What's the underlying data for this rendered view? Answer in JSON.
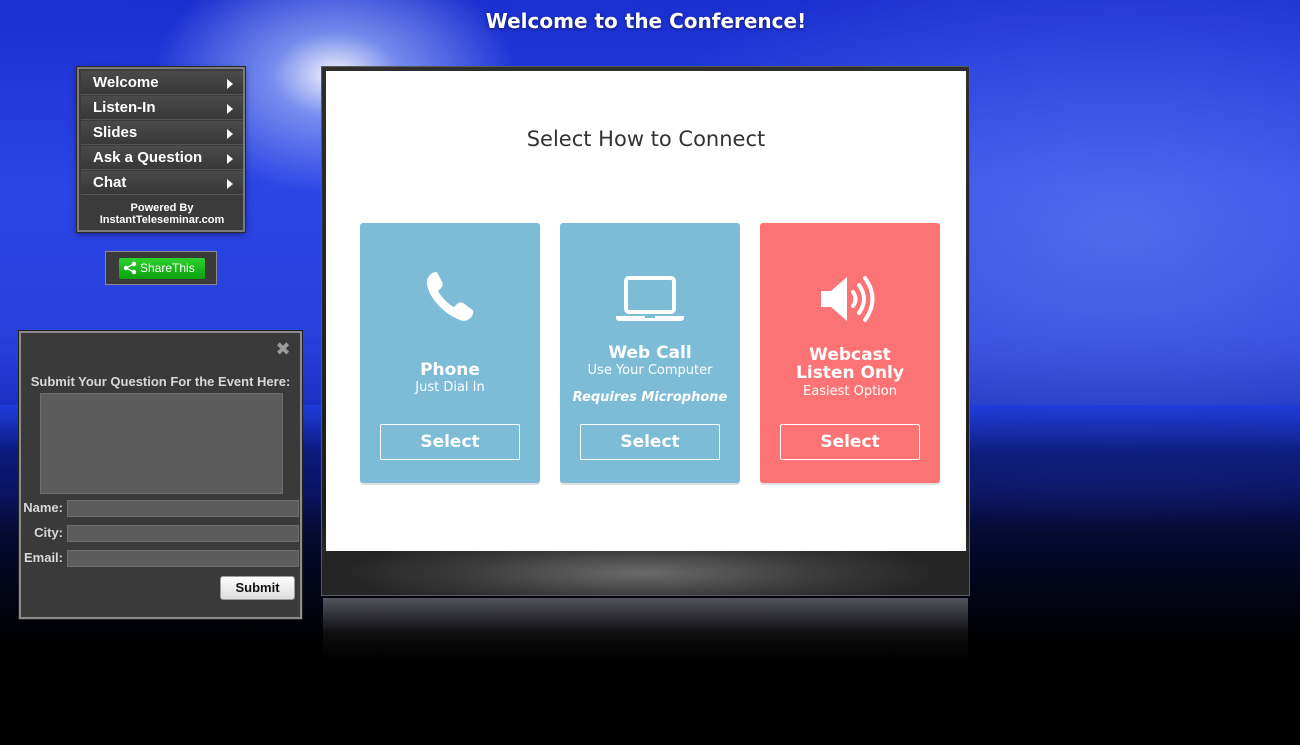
{
  "page": {
    "title": "Welcome to the Conference!"
  },
  "nav": {
    "items": [
      {
        "label": "Welcome"
      },
      {
        "label": "Listen-In"
      },
      {
        "label": "Slides"
      },
      {
        "label": "Ask a Question"
      },
      {
        "label": "Chat"
      }
    ],
    "powered_by_line1": "Powered By",
    "powered_by_line2": "InstantTeleseminar.com"
  },
  "share": {
    "label": "ShareThis",
    "icon": "share-icon",
    "color": "#12b312"
  },
  "connect": {
    "title": "Select How to Connect",
    "cards": [
      {
        "title": "Phone",
        "subtitle": "Just Dial In",
        "note": "",
        "button": "Select",
        "icon": "phone-icon",
        "color": "#7dbcd6"
      },
      {
        "title": "Web Call",
        "subtitle": "Use Your Computer",
        "note": "Requires Microphone",
        "button": "Select",
        "icon": "laptop-icon",
        "color": "#7dbcd6"
      },
      {
        "title_line1": "Webcast",
        "title_line2": "Listen Only",
        "subtitle": "Easiest Option",
        "note": "",
        "button": "Select",
        "icon": "speaker-icon",
        "color": "#fb7374"
      }
    ]
  },
  "question_box": {
    "heading": "Submit Your Question For the Event Here:",
    "question_value": "",
    "name_label": "Name:",
    "city_label": "City:",
    "email_label": "Email:",
    "name_value": "",
    "city_value": "",
    "email_value": "",
    "submit_label": "Submit",
    "close_icon": "close-icon"
  }
}
